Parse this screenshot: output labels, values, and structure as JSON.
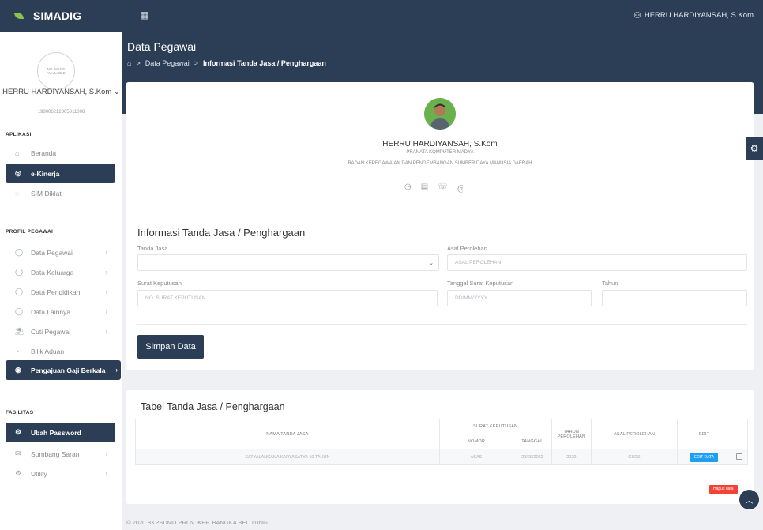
{
  "app": {
    "name": "SIMADIG",
    "menu_icon": "grid-menu-icon"
  },
  "topbar": {
    "user_name": "HERRU HARDIYANSAH, S.Kom",
    "user_icon": "user-icon"
  },
  "header": {
    "title": "Data Pegawai",
    "breadcrumb": {
      "home_icon": "home-icon",
      "sep": ">",
      "level1": "Data Pegawai",
      "current": "Informasi Tanda Jasa / Penghargaan"
    }
  },
  "sidebar": {
    "avatar_placeholder": "NO IMAGE AVAILABLE",
    "user_name": "HERRU HARDIYANSAH, S.Kom",
    "user_nip": "198006212005011008",
    "section_aplikasi": "APLIKASI",
    "item_beranda": "Beranda",
    "item_ekinerja": "e-Kinerja",
    "item_simdiklat": "SIM Diklat",
    "section_profil": "PROFIL PEGAWAI",
    "item_data_pegawai": "Data Pegawai",
    "item_data_keluarga": "Data Keluarga",
    "item_data_pendidikan": "Data Pendidikan",
    "item_data_lainnya": "Data Lainnya",
    "item_cuti": "Cuti Pegawai",
    "item_bilik": "Bilik Aduan",
    "item_gaji": "Pengajuan Gaji Berkala",
    "section_fasilitas": "FASILITAS",
    "item_password": "Ubah Password",
    "item_saran": "Sumbang Saran",
    "item_utility": "Utility"
  },
  "profile": {
    "name": "HERRU HARDIYANSAH, S.Kom",
    "job": "PRANATA KOMPUTER MADYA",
    "org": "BADAN KEPEGAWAIAN DAN PENGEMBANGAN SUMBER DAYA MANUSIA DAERAH",
    "icons": [
      "clock-icon",
      "calendar-icon",
      "phone-icon",
      "at-icon"
    ]
  },
  "form": {
    "title": "Informasi Tanda Jasa / Penghargaan",
    "tanda_jasa_label": "Tanda Jasa",
    "tanda_jasa_value": "",
    "asal_label": "Asal Perolehan",
    "asal_placeholder": "ASAL PEROLEHAN",
    "surat_label": "Surat Keputusan",
    "surat_placeholder": "NO. SURAT KEPUTUSAN",
    "tanggal_label": "Tanggal Surat Keputusan",
    "tanggal_placeholder": "DD/MM/YYYY",
    "tahun_label": "Tahun",
    "tahun_placeholder": "",
    "save_label": "Simpan Data"
  },
  "table": {
    "title": "Tabel Tanda Jasa / Penghargaan",
    "headers": {
      "nama": "NAMA TANDA JASA",
      "surat": "SURAT KEPUTUSAN",
      "nomor": "NOMOR",
      "tanggal": "TANGGAL",
      "tahun": "TAHUN PEROLEHAN",
      "asal": "ASAL PEROLEHAN",
      "edit": "EDIT"
    },
    "rows": [
      {
        "nama": "SATYALANCANA KARYASATYA 10 TAHUN",
        "nomor": "ASAS",
        "tanggal": "20/20/2022",
        "tahun": "2020",
        "asal": "CSCS",
        "edit_label": "EDIT DATA"
      }
    ],
    "delete_label": "Hapus data"
  },
  "footer": {
    "text": "© 2020 BKPSDMD PROV. KEP. BANGKA BELITUNG"
  }
}
